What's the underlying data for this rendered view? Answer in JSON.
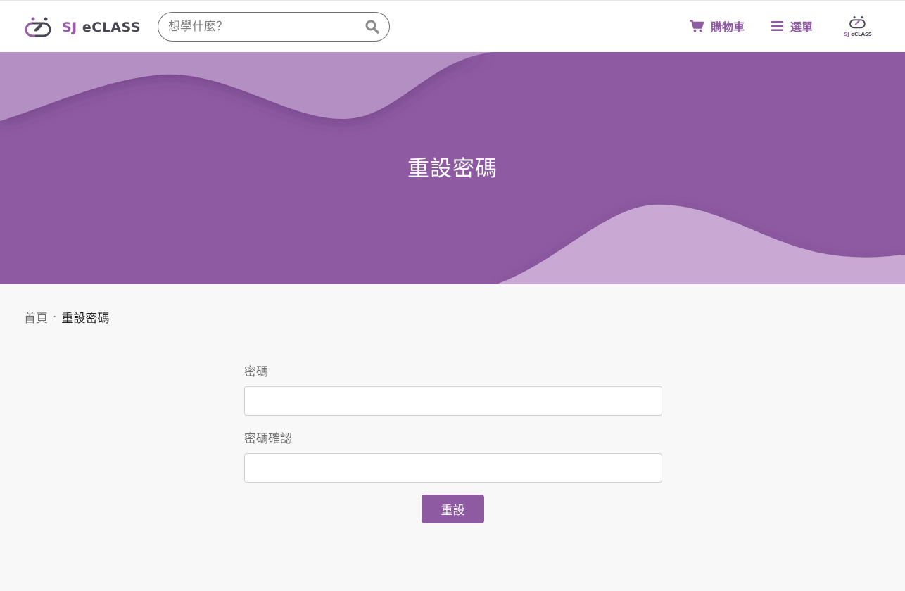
{
  "header": {
    "logo": {
      "sj": "SJ",
      "eclass": "eCLASS"
    },
    "search": {
      "placeholder": "想學什麼？"
    },
    "nav": {
      "cart_label": "購物車",
      "menu_label": "選單"
    },
    "mini_logo": {
      "sj": "SJ",
      "eclass": "eCLASS"
    }
  },
  "banner": {
    "title": "重設密碼"
  },
  "breadcrumb": {
    "home": "首頁",
    "separator": "·",
    "current": "重設密碼"
  },
  "form": {
    "password_label": "密碼",
    "password_value": "",
    "confirm_label": "密碼確認",
    "confirm_value": "",
    "submit_label": "重設"
  },
  "colors": {
    "brand_purple": "#8e5ba2",
    "light_wave": "#b48fc3",
    "lighter_wave": "#c9a8d4",
    "logo_dark": "#4a4654"
  },
  "icons": [
    "logo-mark-icon",
    "search-icon",
    "cart-icon",
    "hamburger-icon"
  ]
}
